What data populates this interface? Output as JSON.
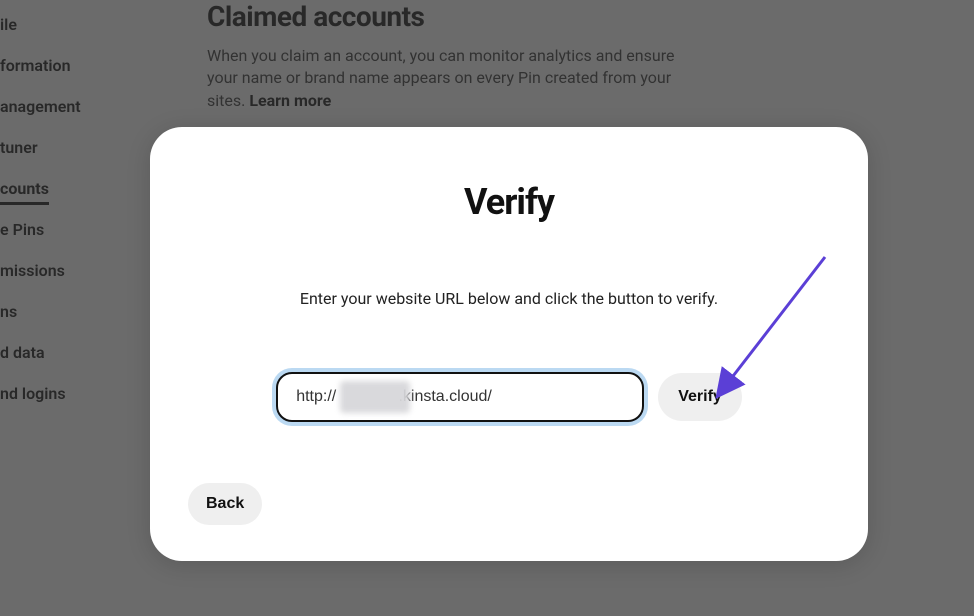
{
  "sidebar": {
    "items": [
      {
        "label": "ile"
      },
      {
        "label": "formation"
      },
      {
        "label": "anagement"
      },
      {
        "label": " tuner"
      },
      {
        "label": "counts"
      },
      {
        "label": "e Pins"
      },
      {
        "label": "missions"
      },
      {
        "label": "ns"
      },
      {
        "label": "d data"
      },
      {
        "label": "nd logins"
      }
    ],
    "active_index": 4
  },
  "page": {
    "title": "Claimed accounts",
    "description_part1": "When you claim an account, you can monitor analytics and ensure your name or brand name appears on every Pin created from your sites. ",
    "learn_more": "Learn more"
  },
  "modal": {
    "title": "Verify",
    "instruction": "Enter your website URL below and click the button to verify.",
    "url_value": "http://              .kinsta.cloud/",
    "verify_label": "Verify",
    "back_label": "Back"
  }
}
